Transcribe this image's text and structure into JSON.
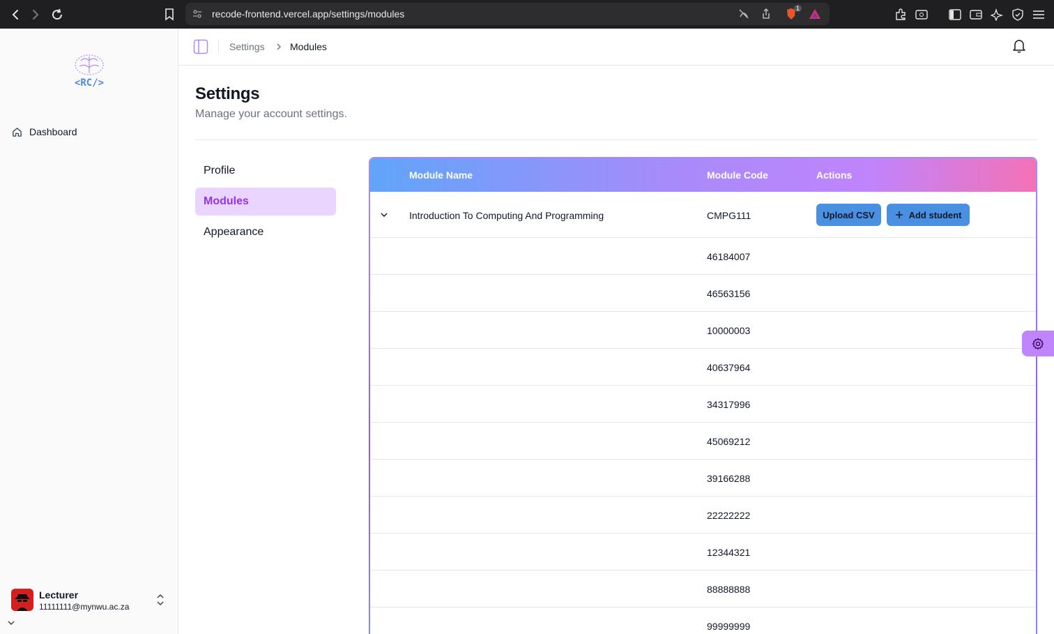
{
  "browser": {
    "url": "recode-frontend.vercel.app/settings/modules",
    "brave_badge_count": "1"
  },
  "sidebar": {
    "logo_text": "<RC/>",
    "nav": [
      {
        "label": "Dashboard",
        "icon": "home-icon"
      }
    ],
    "user": {
      "name": "Lecturer",
      "email": "11111111@mynwu.ac.za"
    }
  },
  "header": {
    "breadcrumb": [
      "Settings",
      "Modules"
    ]
  },
  "page": {
    "title": "Settings",
    "subtitle": "Manage your account settings."
  },
  "settings_nav": [
    {
      "label": "Profile",
      "active": false
    },
    {
      "label": "Modules",
      "active": true
    },
    {
      "label": "Appearance",
      "active": false
    }
  ],
  "table": {
    "headers": {
      "name": "Module Name",
      "code": "Module Code",
      "actions": "Actions"
    },
    "module": {
      "name": "Introduction To Computing And Programming",
      "code": "CMPG111",
      "upload_label": "Upload CSV",
      "add_label": "Add student"
    },
    "students": [
      "46184007",
      "46563156",
      "10000003",
      "40637964",
      "34317996",
      "45069212",
      "39166288",
      "22222222",
      "12344321",
      "88888888",
      "99999999"
    ]
  },
  "colors": {
    "accent": "#9333ea",
    "active_bg": "#e9d5ff",
    "button": "#4a90e2",
    "header_gradient": [
      "#60a5fa",
      "#a78bfa",
      "#c084fc",
      "#f472b6"
    ]
  }
}
